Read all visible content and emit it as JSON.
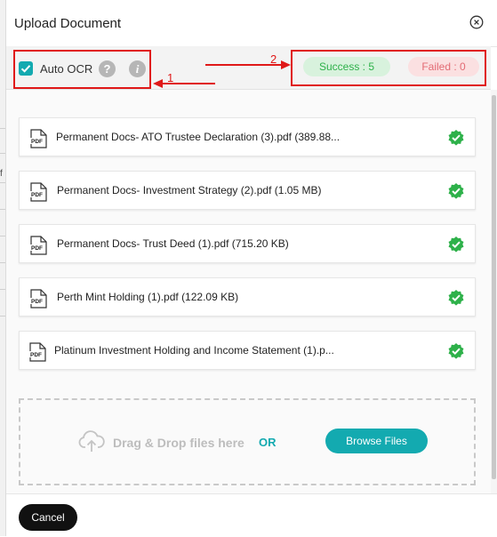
{
  "dialog": {
    "title": "Upload Document"
  },
  "toolbar": {
    "auto_ocr_label": "Auto OCR",
    "auto_ocr_checked": true,
    "help_glyph": "?",
    "info_glyph": "i",
    "success_label": "Success : 5",
    "failed_label": "Failed : 0"
  },
  "annotations": {
    "label_1": "1",
    "label_2": "2"
  },
  "files": [
    {
      "name": "Permanent Docs- ATO Trustee Declaration (3).pdf (389.88...",
      "status": "uploaded"
    },
    {
      "name": "Permanent Docs- Investment Strategy (2).pdf (1.05 MB)",
      "status": "uploaded"
    },
    {
      "name": "Permanent Docs- Trust Deed (1).pdf (715.20 KB)",
      "status": "uploaded"
    },
    {
      "name": "Perth Mint Holding (1).pdf (122.09 KB)",
      "status": "uploaded"
    },
    {
      "name": "Platinum Investment Holding and Income Statement (1).p...",
      "status": "uploaded"
    }
  ],
  "dropzone": {
    "drag_text": "Drag & Drop files here",
    "or_text": "OR",
    "browse_label": "Browse Files"
  },
  "footer": {
    "cancel_label": "Cancel"
  },
  "background": {
    "edge_char": "f"
  },
  "icons": {
    "close": "close-circle-icon",
    "file": "pdf-file-icon",
    "status": "success-check-badge-icon",
    "upload": "cloud-upload-icon"
  },
  "colors": {
    "accent": "#13aab0",
    "success_text": "#2eb14a",
    "success_bg": "#d8f2dd",
    "failed_text": "#e36b74",
    "failed_bg": "#fbe0e1",
    "annotation": "#e01818",
    "check_badge": "#2eb14a"
  }
}
